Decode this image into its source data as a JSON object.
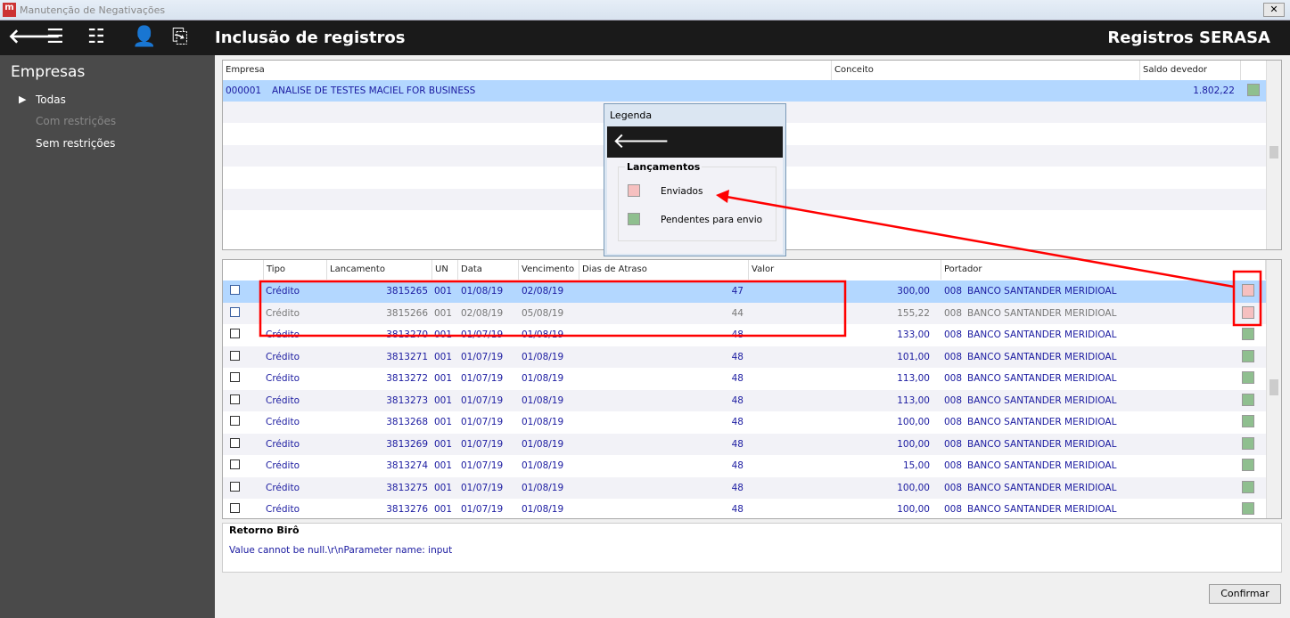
{
  "window": {
    "title": "Manutenção de Negativações",
    "close": "✕"
  },
  "toolbar": {
    "title": "Inclusão de registros",
    "right_title": "Registros SERASA"
  },
  "sidebar": {
    "title": "Empresas",
    "items": [
      {
        "label": "Todas"
      },
      {
        "label": "Com restrições"
      },
      {
        "label": "Sem restrições"
      }
    ]
  },
  "companies": {
    "headers": [
      "Empresa",
      "Conceito",
      "Saldo devedor"
    ],
    "rows": [
      {
        "code": "000001",
        "name": "ANALISE DE TESTES MACIEL FOR BUSINESS",
        "saldo": "1.802,22",
        "status_color": "#8fbf8f"
      }
    ]
  },
  "entries": {
    "headers": [
      "Tipo",
      "Lancamento",
      "UN",
      "Data",
      "Vencimento",
      "Dias de Atraso",
      "Valor",
      "Portador"
    ],
    "rows": [
      {
        "tipo": "Crédito",
        "lanc": "3815265",
        "un": "001",
        "data": "01/08/19",
        "venc": "02/08/19",
        "dias": "47",
        "valor": "300,00",
        "port": "008",
        "banco": "BANCO SANTANDER MERIDIOAL",
        "status": "enviado"
      },
      {
        "tipo": "Crédito",
        "lanc": "3815266",
        "un": "001",
        "data": "02/08/19",
        "venc": "05/08/19",
        "dias": "44",
        "valor": "155,22",
        "port": "008",
        "banco": "BANCO SANTANDER MERIDIOAL",
        "status": "enviado"
      },
      {
        "tipo": "Crédito",
        "lanc": "3813270",
        "un": "001",
        "data": "01/07/19",
        "venc": "01/08/19",
        "dias": "48",
        "valor": "133,00",
        "port": "008",
        "banco": "BANCO SANTANDER MERIDIOAL",
        "status": "pendente"
      },
      {
        "tipo": "Crédito",
        "lanc": "3813271",
        "un": "001",
        "data": "01/07/19",
        "venc": "01/08/19",
        "dias": "48",
        "valor": "101,00",
        "port": "008",
        "banco": "BANCO SANTANDER MERIDIOAL",
        "status": "pendente"
      },
      {
        "tipo": "Crédito",
        "lanc": "3813272",
        "un": "001",
        "data": "01/07/19",
        "venc": "01/08/19",
        "dias": "48",
        "valor": "113,00",
        "port": "008",
        "banco": "BANCO SANTANDER MERIDIOAL",
        "status": "pendente"
      },
      {
        "tipo": "Crédito",
        "lanc": "3813273",
        "un": "001",
        "data": "01/07/19",
        "venc": "01/08/19",
        "dias": "48",
        "valor": "113,00",
        "port": "008",
        "banco": "BANCO SANTANDER MERIDIOAL",
        "status": "pendente"
      },
      {
        "tipo": "Crédito",
        "lanc": "3813268",
        "un": "001",
        "data": "01/07/19",
        "venc": "01/08/19",
        "dias": "48",
        "valor": "100,00",
        "port": "008",
        "banco": "BANCO SANTANDER MERIDIOAL",
        "status": "pendente"
      },
      {
        "tipo": "Crédito",
        "lanc": "3813269",
        "un": "001",
        "data": "01/07/19",
        "venc": "01/08/19",
        "dias": "48",
        "valor": "100,00",
        "port": "008",
        "banco": "BANCO SANTANDER MERIDIOAL",
        "status": "pendente"
      },
      {
        "tipo": "Crédito",
        "lanc": "3813274",
        "un": "001",
        "data": "01/07/19",
        "venc": "01/08/19",
        "dias": "48",
        "valor": "15,00",
        "port": "008",
        "banco": "BANCO SANTANDER MERIDIOAL",
        "status": "pendente"
      },
      {
        "tipo": "Crédito",
        "lanc": "3813275",
        "un": "001",
        "data": "01/07/19",
        "venc": "01/08/19",
        "dias": "48",
        "valor": "100,00",
        "port": "008",
        "banco": "BANCO SANTANDER MERIDIOAL",
        "status": "pendente"
      },
      {
        "tipo": "Crédito",
        "lanc": "3813276",
        "un": "001",
        "data": "01/07/19",
        "venc": "01/08/19",
        "dias": "48",
        "valor": "100,00",
        "port": "008",
        "banco": "BANCO SANTANDER MERIDIOAL",
        "status": "pendente"
      }
    ]
  },
  "colors": {
    "enviado": "#f6c0c0",
    "pendente": "#8fbf8f",
    "selected": "#b3d7ff",
    "annotation": "#ff0000"
  },
  "legend": {
    "title": "Legenda",
    "group": "Lançamentos",
    "items": [
      {
        "label": "Enviados",
        "color": "#f6c0c0"
      },
      {
        "label": "Pendentes para envio",
        "color": "#8fbf8f"
      }
    ]
  },
  "retorno": {
    "title": "Retorno Birô",
    "message": "Value cannot be null.\\r\\nParameter name: input"
  },
  "buttons": {
    "confirm": "Confirmar"
  }
}
